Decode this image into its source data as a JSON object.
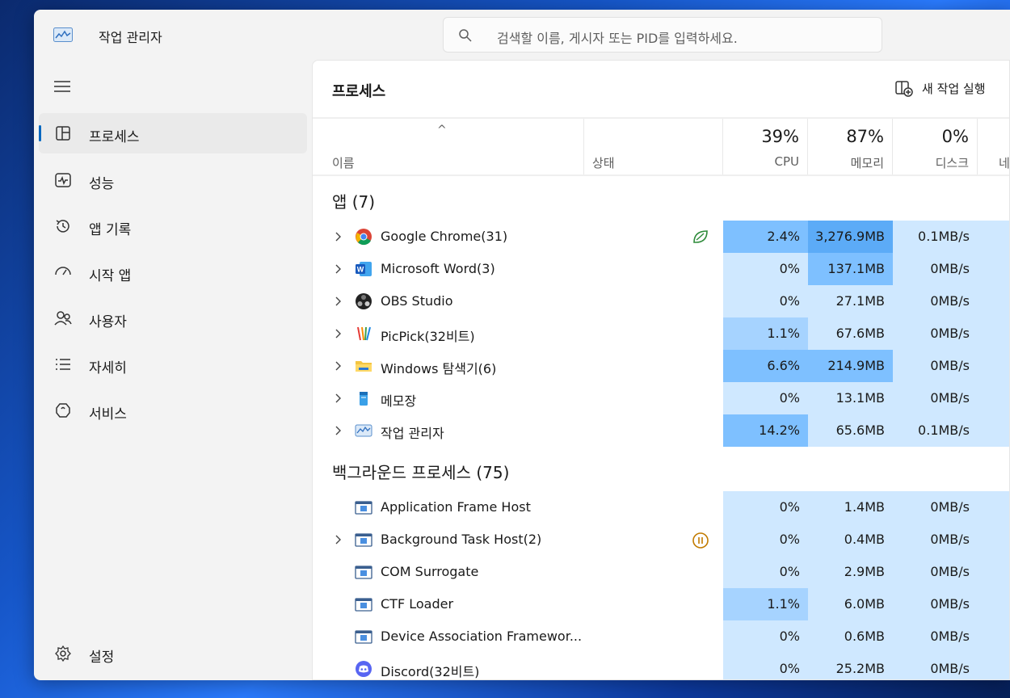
{
  "app": {
    "title": "작업 관리자"
  },
  "search": {
    "placeholder": "검색할 이름, 게시자 또는 PID를 입력하세요."
  },
  "sidebar": {
    "items": [
      {
        "label": "프로세스",
        "icon": "processes-icon",
        "active": true
      },
      {
        "label": "성능",
        "icon": "performance-icon",
        "active": false
      },
      {
        "label": "앱 기록",
        "icon": "app-history-icon",
        "active": false
      },
      {
        "label": "시작 앱",
        "icon": "startup-apps-icon",
        "active": false
      },
      {
        "label": "사용자",
        "icon": "users-icon",
        "active": false
      },
      {
        "label": "자세히",
        "icon": "details-icon",
        "active": false
      },
      {
        "label": "서비스",
        "icon": "services-icon",
        "active": false
      }
    ],
    "settings_label": "설정"
  },
  "main": {
    "title": "프로세스",
    "run_new_task": "새 작업 실행",
    "columns": {
      "name": "이름",
      "status": "상태",
      "cpu": {
        "percent": "39%",
        "label": "CPU"
      },
      "memory": {
        "percent": "87%",
        "label": "메모리"
      },
      "disk": {
        "percent": "0%",
        "label": "디스크"
      },
      "network": {
        "label": "네"
      }
    },
    "groups": {
      "apps": "앱 (7)",
      "background": "백그라운드 프로세스 (75)"
    },
    "apps": [
      {
        "name": "Google Chrome(31)",
        "icon": "chrome-icon",
        "status": "efficiency-leaf-icon",
        "cpu": "2.4%",
        "memory": "3,276.9MB",
        "disk": "0.1MB/s",
        "cpu_heat": 3,
        "mem_heat": 4,
        "expandable": true
      },
      {
        "name": "Microsoft Word(3)",
        "icon": "word-icon",
        "status": "",
        "cpu": "0%",
        "memory": "137.1MB",
        "disk": "0MB/s",
        "cpu_heat": 1,
        "mem_heat": 3,
        "expandable": true
      },
      {
        "name": "OBS Studio",
        "icon": "obs-icon",
        "status": "",
        "cpu": "0%",
        "memory": "27.1MB",
        "disk": "0MB/s",
        "cpu_heat": 1,
        "mem_heat": 1,
        "expandable": true
      },
      {
        "name": "PicPick(32비트)",
        "icon": "picpick-icon",
        "status": "",
        "cpu": "1.1%",
        "memory": "67.6MB",
        "disk": "0MB/s",
        "cpu_heat": 2,
        "mem_heat": 1,
        "expandable": true
      },
      {
        "name": "Windows 탐색기(6)",
        "icon": "folder-icon",
        "status": "",
        "cpu": "6.6%",
        "memory": "214.9MB",
        "disk": "0MB/s",
        "cpu_heat": 3,
        "mem_heat": 3,
        "expandable": true
      },
      {
        "name": "메모장",
        "icon": "notepad-icon",
        "status": "",
        "cpu": "0%",
        "memory": "13.1MB",
        "disk": "0MB/s",
        "cpu_heat": 1,
        "mem_heat": 1,
        "expandable": true
      },
      {
        "name": "작업 관리자",
        "icon": "task-manager-icon",
        "status": "",
        "cpu": "14.2%",
        "memory": "65.6MB",
        "disk": "0.1MB/s",
        "cpu_heat": 3,
        "mem_heat": 1,
        "expandable": true
      }
    ],
    "background": [
      {
        "name": "Application Frame Host",
        "icon": "window-icon",
        "status": "",
        "cpu": "0%",
        "memory": "1.4MB",
        "disk": "0MB/s",
        "cpu_heat": 1,
        "mem_heat": 1,
        "expandable": false
      },
      {
        "name": "Background Task Host(2)",
        "icon": "window-icon",
        "status": "paused-icon",
        "cpu": "0%",
        "memory": "0.4MB",
        "disk": "0MB/s",
        "cpu_heat": 1,
        "mem_heat": 1,
        "expandable": true
      },
      {
        "name": "COM Surrogate",
        "icon": "window-icon",
        "status": "",
        "cpu": "0%",
        "memory": "2.9MB",
        "disk": "0MB/s",
        "cpu_heat": 1,
        "mem_heat": 1,
        "expandable": false
      },
      {
        "name": "CTF Loader",
        "icon": "window-icon",
        "status": "",
        "cpu": "1.1%",
        "memory": "6.0MB",
        "disk": "0MB/s",
        "cpu_heat": 2,
        "mem_heat": 1,
        "expandable": false
      },
      {
        "name": "Device Association Framewor...",
        "icon": "window-icon",
        "status": "",
        "cpu": "0%",
        "memory": "0.6MB",
        "disk": "0MB/s",
        "cpu_heat": 1,
        "mem_heat": 1,
        "expandable": false
      },
      {
        "name": "Discord(32비트)",
        "icon": "discord-icon",
        "status": "",
        "cpu": "0%",
        "memory": "25.2MB",
        "disk": "0MB/s",
        "cpu_heat": 1,
        "mem_heat": 1,
        "expandable": false
      }
    ]
  },
  "colors": {
    "heat1": "#cfe8ff",
    "heat2": "#a6d3ff",
    "heat3": "#7ec0ff",
    "heat4": "#5cabf7",
    "accent": "#0067c0"
  }
}
